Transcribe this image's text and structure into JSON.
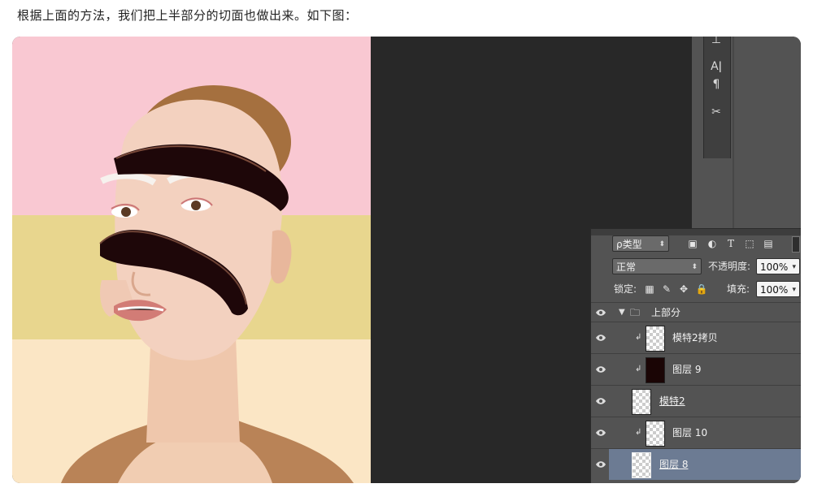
{
  "caption": "根据上面的方法，我们把上半部分的切面也做出来。如下图：",
  "tools": [
    "Aǀ",
    "¶",
    "✂"
  ],
  "layers_panel": {
    "filter_kind": "ρ类型",
    "blend_mode": "正常",
    "opacity_label": "不透明度:",
    "opacity_value": "100%",
    "lock_label": "锁定:",
    "fill_label": "填充:",
    "fill_value": "100%",
    "group_name": "上部分",
    "layers": [
      {
        "name": "模特2拷贝",
        "clipped": true,
        "thumb": "transparent",
        "selected": false,
        "underline": false
      },
      {
        "name": "图层 9",
        "clipped": true,
        "thumb": "dark",
        "selected": false,
        "underline": false
      },
      {
        "name": "模特2",
        "clipped": false,
        "thumb": "transparent",
        "selected": false,
        "underline": true
      },
      {
        "name": "图层 10",
        "clipped": true,
        "thumb": "transparent",
        "selected": false,
        "underline": false
      },
      {
        "name": "图层 8",
        "clipped": false,
        "thumb": "transparent",
        "selected": true,
        "underline": true
      }
    ]
  },
  "colors": {
    "band_pink": "#f9c8d2",
    "band_yellow": "#e8d68e",
    "band_cream": "#fbe6c5",
    "cut_band": "#1e0709",
    "selected_row": "#6c7b93"
  }
}
